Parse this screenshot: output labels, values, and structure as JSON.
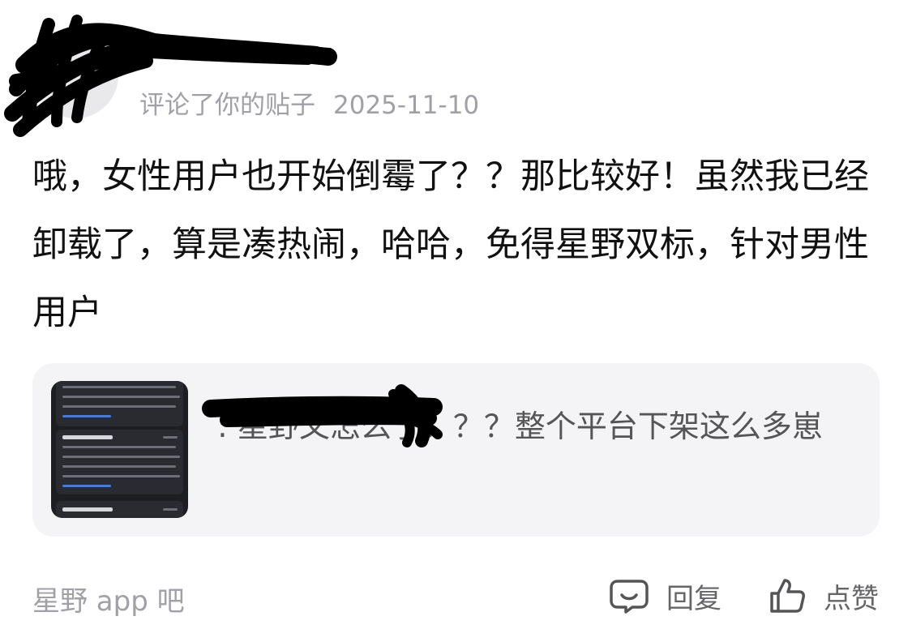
{
  "notification": {
    "user_name": "",
    "action_text": "评论了你的贴子",
    "date": "2025-11-10"
  },
  "comment": {
    "text": "哦，女性用户也开始倒霉了？？那比较好！虽然我已经卸载了，算是凑热闹，哈哈，免得星野双标，针对男性用户"
  },
  "quoted_post": {
    "author": "",
    "separator": ": ",
    "text": "星野又怎么了？？？整个平台下架这么多崽",
    "thumbnail": {
      "icon": "screenshot-thumbnail",
      "notice_title": "智能体违规通知"
    }
  },
  "footer": {
    "forum": "星野 app 吧",
    "reply_label": "回复",
    "like_label": "点赞",
    "reply_icon": "comment-bubble-icon",
    "like_icon": "thumbs-up-icon"
  },
  "colors": {
    "meta_gray": "#a0a0a6",
    "card_bg": "#f4f4f7",
    "quote_user": "#6e72c9"
  }
}
